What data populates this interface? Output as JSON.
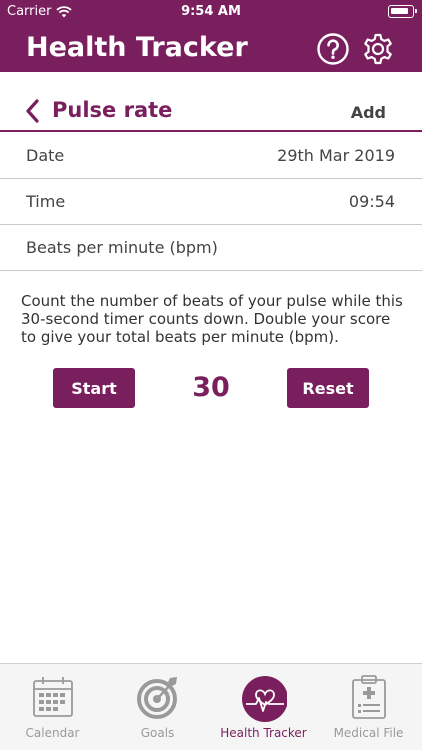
{
  "status_bar": {
    "carrier": "Carrier",
    "time": "9:54 AM"
  },
  "header": {
    "title": "Health Tracker",
    "help_icon": "help-icon",
    "settings_icon": "gear-icon"
  },
  "subheader": {
    "title": "Pulse rate",
    "add_label": "Add"
  },
  "fields": {
    "date": {
      "label": "Date",
      "value": "29th Mar 2019"
    },
    "time": {
      "label": "Time",
      "value": "09:54"
    },
    "bpm": {
      "label": "Beats per minute (bpm)",
      "value": ""
    }
  },
  "instructions": "Count the number of beats of your pulse while this 30-second timer counts down. Double your score to give your total beats per minute (bpm).",
  "timer": {
    "start_label": "Start",
    "count": "30",
    "reset_label": "Reset"
  },
  "tabs": [
    {
      "label": "Calendar",
      "icon": "calendar-icon",
      "active": false
    },
    {
      "label": "Goals",
      "icon": "target-icon",
      "active": false
    },
    {
      "label": "Health Tracker",
      "icon": "heartbeat-icon",
      "active": true
    },
    {
      "label": "Medical File",
      "icon": "clipboard-icon",
      "active": false
    }
  ],
  "colors": {
    "brand": "#7a1f5e",
    "inactive": "#9a9a9a",
    "divider": "#c9c9c9"
  }
}
